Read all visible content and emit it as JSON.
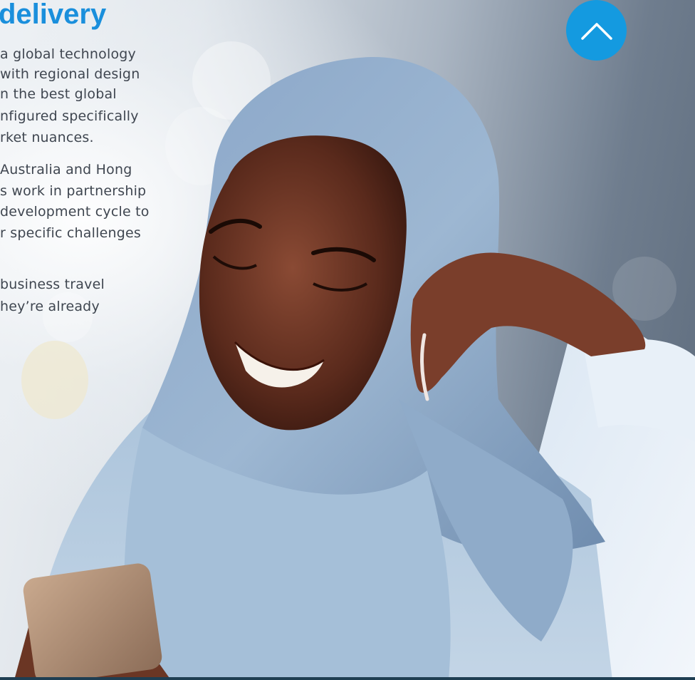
{
  "heading": "delivery",
  "paragraph1": [
    "a global technology",
    "with regional design",
    "n the best global",
    "nfigured specifically",
    "rket nuances."
  ],
  "paragraph2": [
    "Australia and Hong",
    "s work in partnership",
    "development cycle to",
    "r specific challenges"
  ],
  "paragraph3": [
    " business travel",
    "hey’re already"
  ],
  "scroll_top": {
    "icon": "chevron-up-icon",
    "color": "#149ae0"
  },
  "colors": {
    "accent": "#1a8fdc",
    "body_text": "#3f4650"
  }
}
